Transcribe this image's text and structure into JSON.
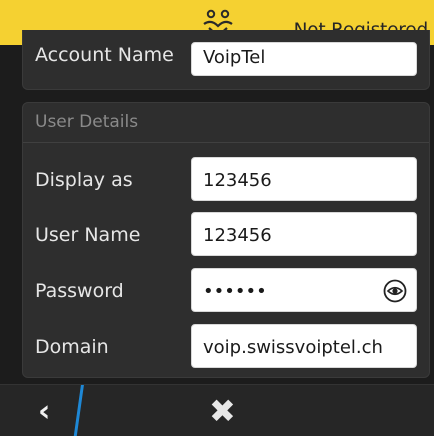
{
  "status_bar": {
    "status_text": "Not Registered",
    "logo_icon": "people-icon",
    "background": "#f5d131"
  },
  "account": {
    "account_name_label": "Account Name",
    "account_name_value": "VoipTel"
  },
  "user_details": {
    "section_title": "User Details",
    "display_as_label": "Display as",
    "display_as_value": "123456",
    "user_name_label": "User Name",
    "user_name_value": "123456",
    "password_label": "Password",
    "password_value": "••••••",
    "password_reveal_icon": "eye-icon",
    "domain_label": "Domain",
    "domain_value": "voip.swissvoiptel.ch"
  },
  "bottom_bar": {
    "back_glyph": "‹",
    "back_icon": "chevron-left-icon",
    "close_glyph": "✖",
    "close_icon": "close-icon",
    "accent": "#1e88d6"
  }
}
